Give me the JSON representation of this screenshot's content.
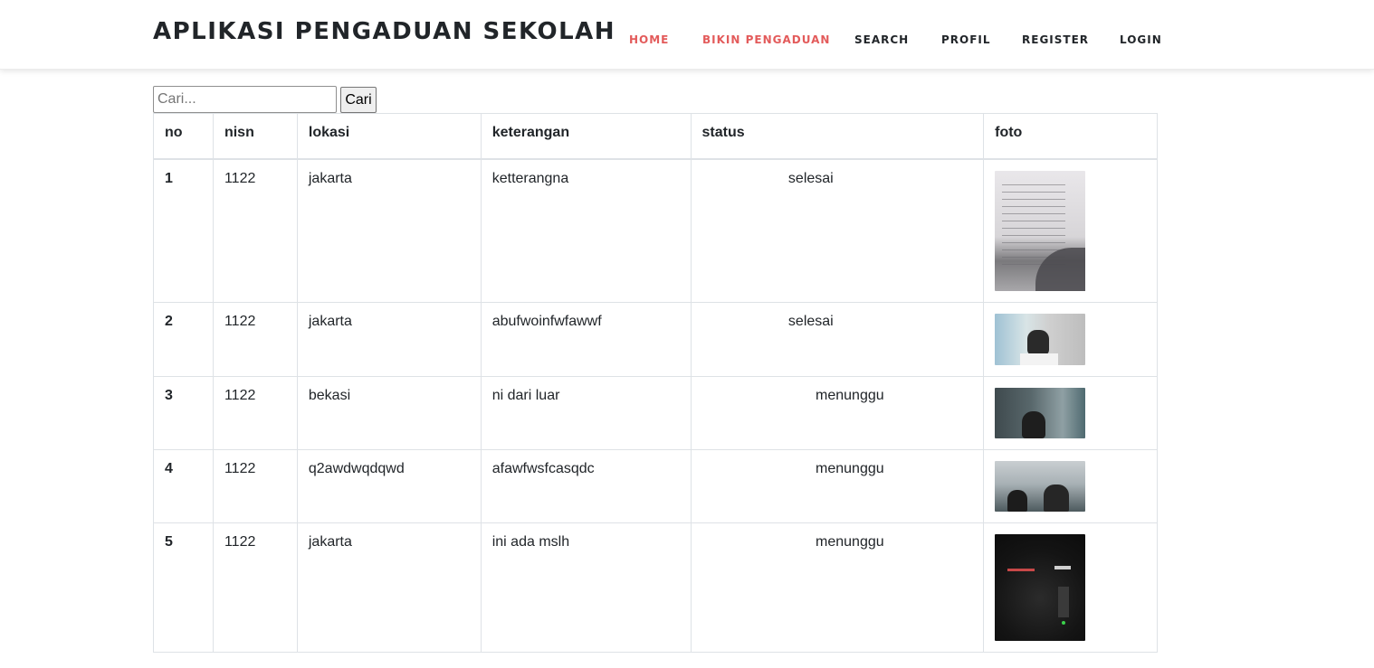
{
  "header": {
    "brand": "APLIKASI PENGADUAN SEKOLAH",
    "nav": [
      {
        "label": "HOME",
        "active": true
      },
      {
        "label": "BIKIN PENGADUAN",
        "active": true
      },
      {
        "label": "SEARCH",
        "active": false
      },
      {
        "label": "PROFIL",
        "active": false
      },
      {
        "label": "REGISTER",
        "active": false
      },
      {
        "label": "LOGIN",
        "active": false
      }
    ],
    "active_color": "#e35b5b"
  },
  "search": {
    "placeholder": "Cari...",
    "value": "",
    "button_label": "Cari"
  },
  "table": {
    "columns": [
      "no",
      "nisn",
      "lokasi",
      "keterangan",
      "status",
      "foto"
    ],
    "rows": [
      {
        "no": "1",
        "nisn": "1122",
        "lokasi": "jakarta",
        "keterangan": "ketterangna",
        "status": "selesai",
        "foto": "handwritten-notes-photo"
      },
      {
        "no": "2",
        "nisn": "1122",
        "lokasi": "jakarta",
        "keterangan": "abufwoinfwfawwf",
        "status": "selesai",
        "foto": "classroom-student-photo"
      },
      {
        "no": "3",
        "nisn": "1122",
        "lokasi": "bekasi",
        "keterangan": "ni dari luar",
        "status": "menunggu",
        "foto": "student-selfie-photo"
      },
      {
        "no": "4",
        "nisn": "1122",
        "lokasi": "q2awdwqdqwd",
        "keterangan": "afawfwsfcasqdc",
        "status": "menunggu",
        "foto": "students-ceiling-photo"
      },
      {
        "no": "5",
        "nisn": "1122",
        "lokasi": "jakarta",
        "keterangan": "ini ada mslh",
        "status": "menunggu",
        "foto": "dark-game-screenshot"
      }
    ]
  }
}
